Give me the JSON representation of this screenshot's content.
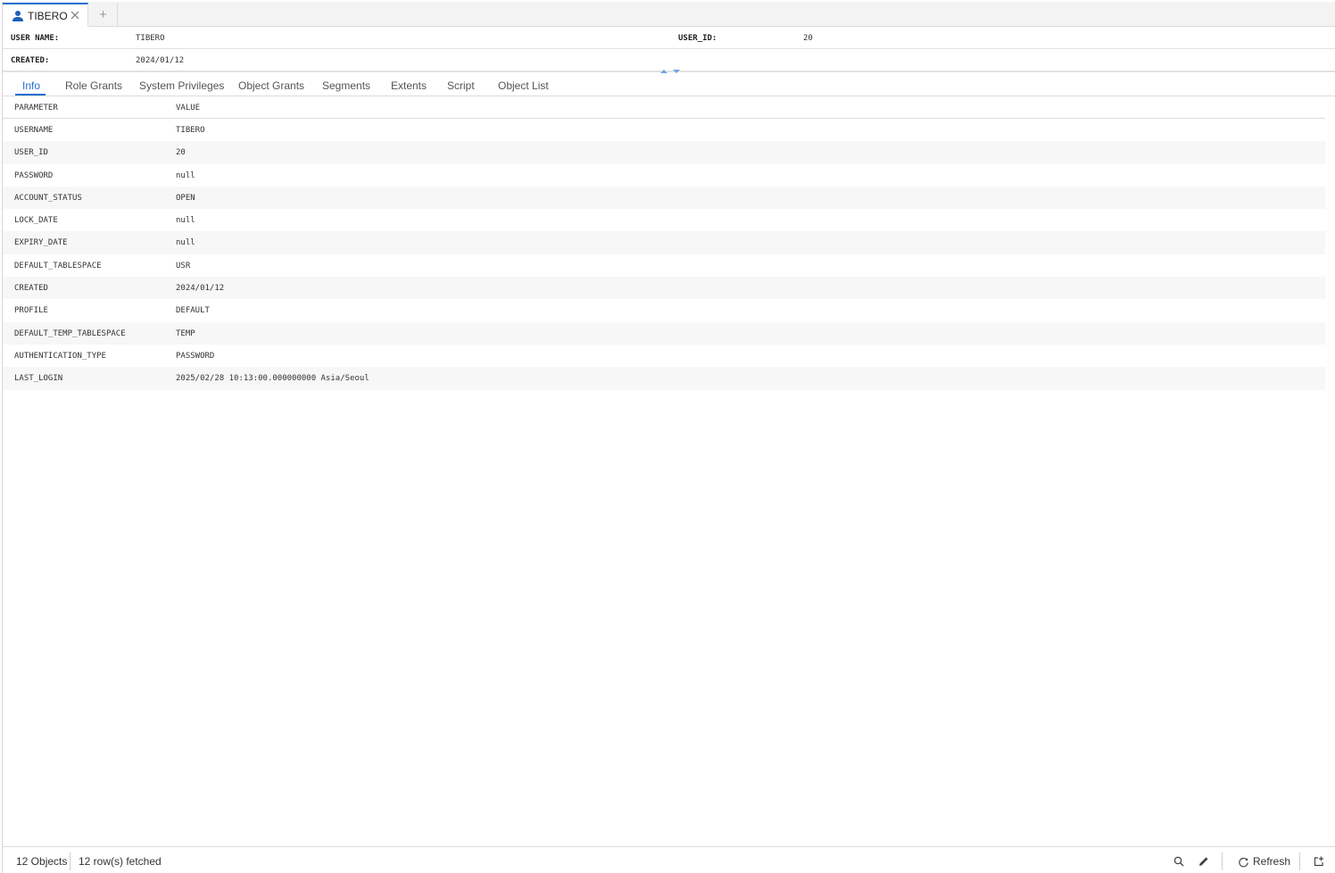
{
  "tab": {
    "title": "TIBERO",
    "add_label": "+"
  },
  "header": {
    "user_name_label": "USER NAME:",
    "user_name_value": "TIBERO",
    "user_id_label": "USER_ID:",
    "user_id_value": "20",
    "created_label": "CREATED:",
    "created_value": "2024/01/12"
  },
  "subtabs": [
    "Info",
    "Role Grants",
    "System Privileges",
    "Object Grants",
    "Segments",
    "Extents",
    "Script",
    "Object List"
  ],
  "grid": {
    "columns": [
      "PARAMETER",
      "VALUE"
    ],
    "rows": [
      [
        "USERNAME",
        "TIBERO"
      ],
      [
        "USER_ID",
        "20"
      ],
      [
        "PASSWORD",
        "null"
      ],
      [
        "ACCOUNT_STATUS",
        "OPEN"
      ],
      [
        "LOCK_DATE",
        "null"
      ],
      [
        "EXPIRY_DATE",
        "null"
      ],
      [
        "DEFAULT_TABLESPACE",
        "USR"
      ],
      [
        "CREATED",
        "2024/01/12"
      ],
      [
        "PROFILE",
        "DEFAULT"
      ],
      [
        "DEFAULT_TEMP_TABLESPACE",
        "TEMP"
      ],
      [
        "AUTHENTICATION_TYPE",
        "PASSWORD"
      ],
      [
        "LAST_LOGIN",
        "2025/02/28 10:13:00.000000000 Asia/Seoul"
      ]
    ]
  },
  "status": {
    "objects": "12 Objects",
    "fetched": "12 row(s) fetched",
    "refresh_label": "Refresh"
  },
  "colors": {
    "accent": "#1f6fd1",
    "row_alt": "#f7f7f7"
  },
  "icons": [
    "user-icon",
    "close-icon",
    "search-icon",
    "edit-icon",
    "refresh-icon",
    "export-icon"
  ]
}
